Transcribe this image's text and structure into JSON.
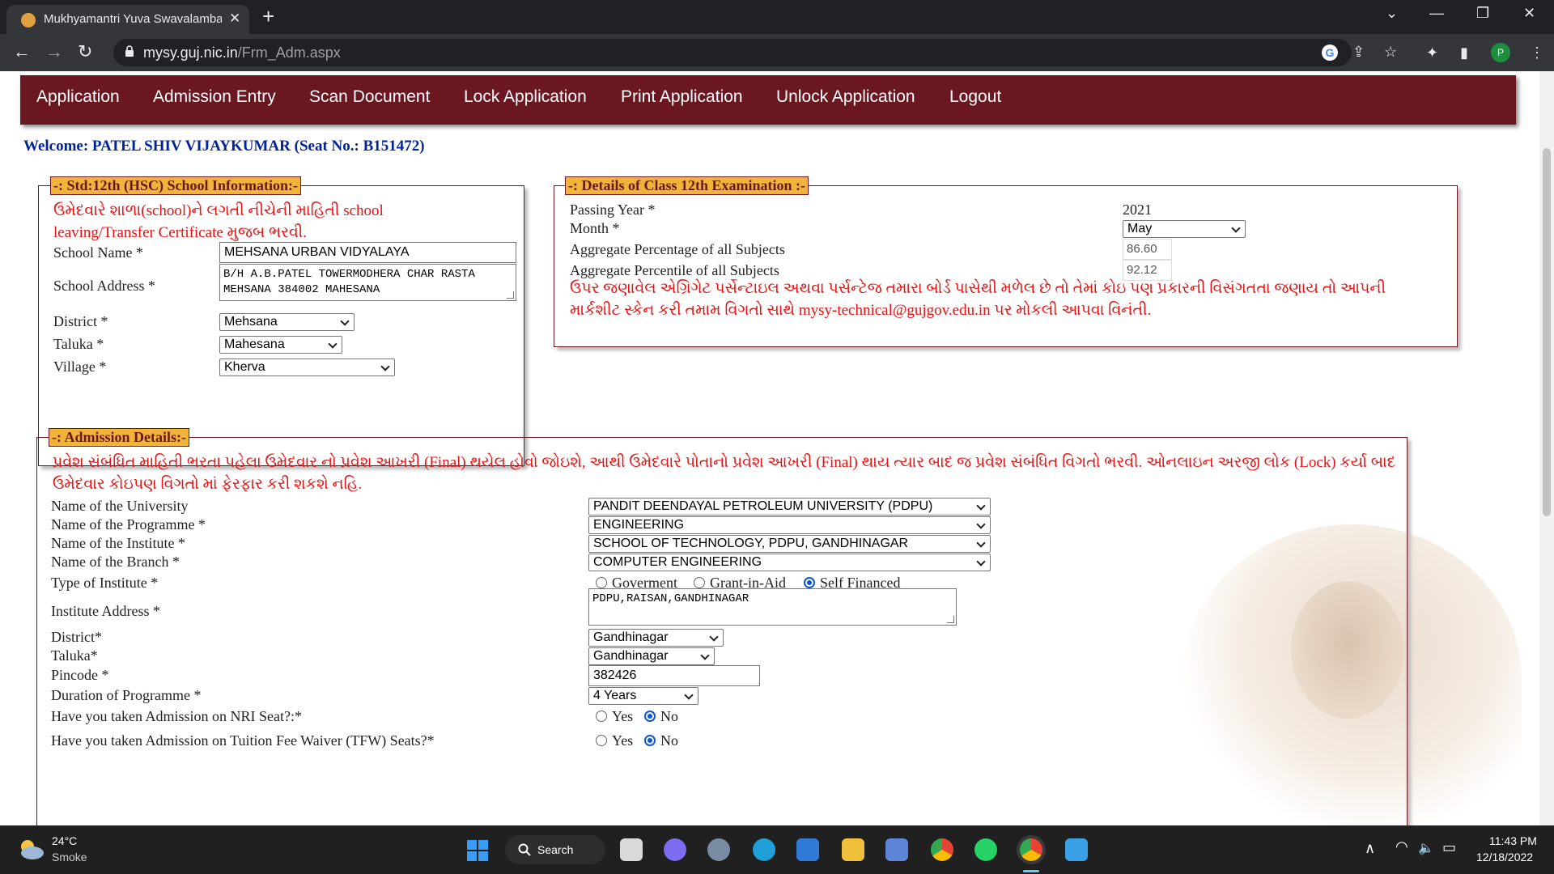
{
  "browser": {
    "tab_title": "Mukhyamantri Yuva Swavalamba",
    "tab_close": "✕",
    "new_tab": "+",
    "url_host": "mysy.guj.nic.in",
    "url_path": "/Frm_Adm.aspx",
    "profile_initial": "P",
    "controls": {
      "minimize": "—",
      "restore": "❐",
      "close": "✕",
      "tab_menu": "⌄"
    },
    "nav": {
      "back": "←",
      "forward": "→",
      "reload": "↻"
    },
    "icons": {
      "google": "G",
      "share": "⇪",
      "star": "☆",
      "extensions": "✦",
      "sidebar": "▮",
      "menu": "⋮"
    }
  },
  "menu": [
    "Application",
    "Admission Entry",
    "Scan Document",
    "Lock Application",
    "Print Application",
    "Unlock Application",
    "Logout"
  ],
  "welcome": "Welcome: PATEL SHIV VIJAYKUMAR (Seat No.: B151472)",
  "school": {
    "legend": "-: Std:12th (HSC) School Information:-",
    "note": "ઉમેદવારે શાળા(school)ને લગતી નીચેની માહિતી school leaving/Transfer Certificate મુજબ ભરવી.",
    "name_label": "School Name *",
    "name_value": "MEHSANA URBAN  VIDYALAYA",
    "address_label": "School Address *",
    "address_value": "B/H A.B.PATEL TOWERMODHERA CHAR RASTA MEHSANA 384002 MAHESANA",
    "district_label": "District *",
    "district_value": "Mehsana",
    "taluka_label": "Taluka *",
    "taluka_value": "Mahesana",
    "village_label": "Village *",
    "village_value": "Kherva"
  },
  "exam": {
    "legend": "-: Details of Class 12th Examination :-",
    "passing_year_label": "Passing Year *",
    "passing_year_value": "2021",
    "month_label": "Month *",
    "month_value": "May",
    "percentage_label": "Aggregate Percentage of all Subjects",
    "percentage_value": "86.60",
    "percentile_label": "Aggregate Percentile of all Subjects",
    "percentile_value": "92.12",
    "note": "ઉપર જણાવેલ એગ્રિગેટ પર્સેન્ટાઇલ અથવા પર્સન્ટેજ તમારા બોર્ડ પાસેથી મળેલ છે તો તેમાં કોઇ પણ પ્રકારની વિસંગતતા જણાય તો આપની માર્કશીટ સ્કેન કરી તમામ વિગતો સાથે mysy-technical@gujgov.edu.in પર મોકલી આપવા વિનંતી."
  },
  "admission": {
    "legend": "-: Admission Details:-",
    "note": "પ્રવેશ સંબંધિત માહિતી ભરતા પહેલા ઉમેદવાર નો પ્રવેશ આખરી (Final) થયેલ હોવો જોઇશે, આથી ઉમેદવારે પોતાનો પ્રવેશ આખરી (Final) થાય ત્યાર બાદ જ પ્રવેશ સંબંધિત વિગતો ભરવી. ઓનલાઇન અરજી લોક (Lock) કર્યા બાદ ઉમેદવાર કોઇપણ વિગતો માં ફેરફાર કરી શકશે નહિ.",
    "university_label": "Name of the University",
    "university_value": "PANDIT DEENDAYAL PETROLEUM UNIVERSITY (PDPU)",
    "programme_label": "Name of  the Programme *",
    "programme_value": "ENGINEERING",
    "institute_label": "Name of the Institute *",
    "institute_value": "SCHOOL OF TECHNOLOGY, PDPU, GANDHINAGAR",
    "branch_label": "Name of the Branch *",
    "branch_value": "COMPUTER ENGINEERING",
    "type_label": "Type of Institute *",
    "type_options": [
      "Goverment",
      "Grant-in-Aid",
      "Self Financed"
    ],
    "address_label": "Institute Address *",
    "address_value": "PDPU,RAISAN,GANDHINAGAR",
    "district_label": "District*",
    "district_value": "Gandhinagar",
    "taluka_label": "Taluka*",
    "taluka_value": "Gandhinagar",
    "pincode_label": "Pincode *",
    "pincode_value": "382426",
    "duration_label": "Duration of Programme *",
    "duration_value": "4 Years",
    "nri_label": "Have you taken Admission on NRI Seat?:*",
    "tfw_label": "Have you taken Admission on Tuition Fee Waiver (TFW) Seats?*",
    "yes": "Yes",
    "no": "No"
  },
  "taskbar": {
    "weather_temp": "24°C",
    "weather_desc": "Smoke",
    "search": "Search",
    "time": "11:43 PM",
    "date": "12/18/2022",
    "tray": {
      "chevron": "∧",
      "wifi": "◠",
      "volume": "🔈",
      "battery": "▭"
    }
  },
  "colors": {
    "menu_bg": "#6b1722",
    "legend_bg": "#f2b33a",
    "note_red": "#e81010",
    "welcome_blue": "#00239c"
  }
}
